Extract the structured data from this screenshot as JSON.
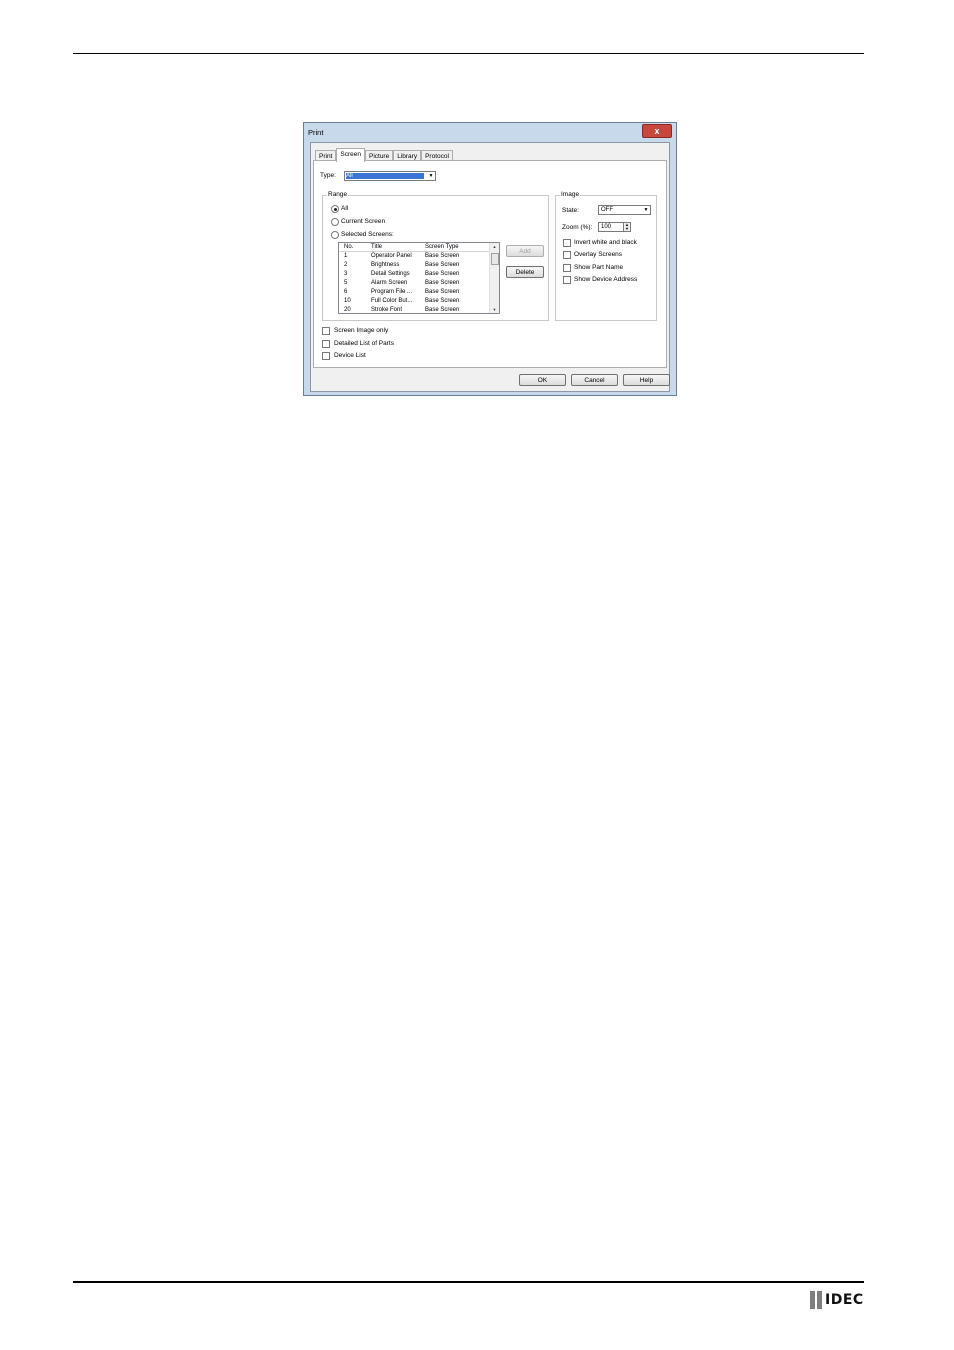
{
  "dialog": {
    "title": "Print",
    "close_symbol": "x",
    "tabs": [
      "Print",
      "Screen",
      "Picture",
      "Library",
      "Protocol"
    ],
    "type_label": "Type:",
    "type_value": "All",
    "range": {
      "title": "Range",
      "options": [
        "All",
        "Current Screen",
        "Selected Screens:"
      ],
      "selected_index": 0
    },
    "list": {
      "columns": [
        "No.",
        "Title",
        "Screen Type"
      ],
      "rows": [
        [
          "1",
          "Operator Panel",
          "Base Screen"
        ],
        [
          "2",
          "Brightness",
          "Base Screen"
        ],
        [
          "3",
          "Detail Settings",
          "Base Screen"
        ],
        [
          "5",
          "Alarm Screen",
          "Base Screen"
        ],
        [
          "6",
          "Program File ...",
          "Base Screen"
        ],
        [
          "10",
          "Full Color But...",
          "Base Screen"
        ],
        [
          "20",
          "Stroke Font",
          "Base Screen"
        ]
      ]
    },
    "add_label": "Add",
    "delete_label": "Delete",
    "image": {
      "title": "Image",
      "state_label": "State:",
      "state_value": "OFF",
      "zoom_label": "Zoom (%):",
      "zoom_value": "100",
      "options": [
        "Invert white and black",
        "Overlay Screens",
        "Show Part Name",
        "Show Device Address"
      ]
    },
    "bottom_options": [
      "Screen Image only",
      "Detailed List of Parts",
      "Device List"
    ],
    "ok_label": "OK",
    "cancel_label": "Cancel",
    "help_label": "Help"
  },
  "footer": {
    "logo_text": "IDEC"
  }
}
